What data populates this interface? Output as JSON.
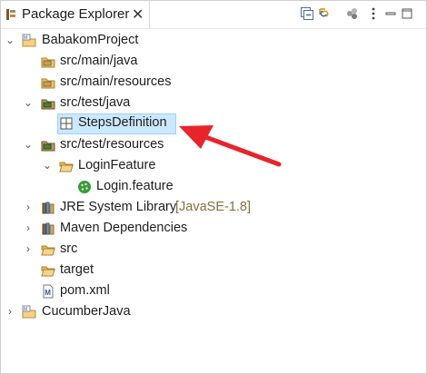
{
  "view": {
    "title": "Package Explorer",
    "close_glyph": "✕",
    "toolbar_icons": [
      "collapse-all-icon",
      "link-with-editor-icon",
      "filters-icon",
      "view-menu-icon",
      "minimize-icon",
      "maximize-icon"
    ]
  },
  "tree": [
    {
      "label": "BabakomProject",
      "icon": "project-icon",
      "expanded": true
    },
    {
      "label": "src/main/java",
      "icon": "source-folder-icon"
    },
    {
      "label": "src/main/resources",
      "icon": "source-folder-icon"
    },
    {
      "label": "src/test/java",
      "icon": "test-source-folder-icon",
      "expanded": true
    },
    {
      "label": "StepsDefinition",
      "icon": "default-package-icon",
      "selected": true
    },
    {
      "label": "src/test/resources",
      "icon": "test-source-folder-icon",
      "expanded": true
    },
    {
      "label": "LoginFeature",
      "icon": "folder-open-icon",
      "expanded": true
    },
    {
      "label": "Login.feature",
      "icon": "cucumber-feature-icon"
    },
    {
      "label": "JRE System Library",
      "decoration": "[JavaSE-1.8]",
      "icon": "library-icon"
    },
    {
      "label": "Maven Dependencies",
      "icon": "library-icon"
    },
    {
      "label": "src",
      "icon": "folder-icon"
    },
    {
      "label": "target",
      "icon": "folder-icon"
    },
    {
      "label": "pom.xml",
      "icon": "maven-file-icon"
    },
    {
      "label": "CucumberJava",
      "icon": "project-icon"
    }
  ],
  "annotation": {
    "color": "#e8242b"
  }
}
